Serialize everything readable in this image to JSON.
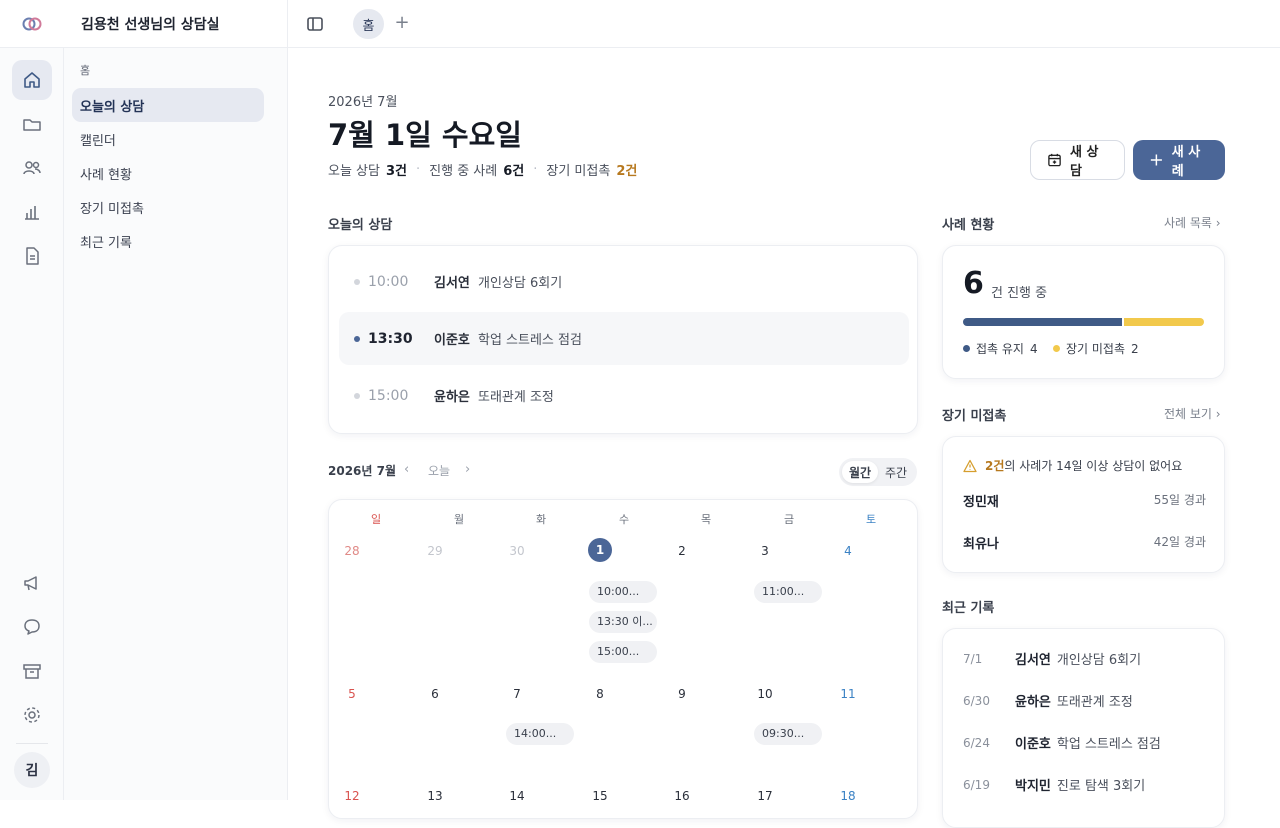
{
  "app": {
    "title": "김용천 선생님의 상담실"
  },
  "tabs": [
    {
      "label": "홈"
    }
  ],
  "user": {
    "avatar": "김"
  },
  "nav": {
    "section": "홈",
    "items": [
      {
        "label": "오늘의 상담",
        "active": true
      },
      {
        "label": "캘린더"
      },
      {
        "label": "사례 현황"
      },
      {
        "label": "장기 미접촉"
      },
      {
        "label": "최근 기록"
      }
    ]
  },
  "header": {
    "year_month": "2026년 7월",
    "date": "7월 1일 수요일",
    "summary": {
      "today_label": "오늘 상담",
      "today_value": "3건",
      "active_label": "진행 중 사례",
      "active_value": "6건",
      "long_label": "장기 미접촉",
      "long_value": "2건"
    },
    "new_session": "새 상담",
    "new_case": "새 사례"
  },
  "today": {
    "title": "오늘의 상담",
    "items": [
      {
        "time": "10:00",
        "name": "김서연",
        "desc": "개인상담 6회기"
      },
      {
        "time": "13:30",
        "name": "이준호",
        "desc": "학업 스트레스 점검"
      },
      {
        "time": "15:00",
        "name": "윤하은",
        "desc": "또래관계 조정"
      }
    ]
  },
  "calendar": {
    "title": "2026년 7월",
    "today_btn": "오늘",
    "view_month": "월간",
    "view_week": "주간",
    "weekdays": [
      "일",
      "월",
      "화",
      "수",
      "목",
      "금",
      "토"
    ],
    "weeks": [
      [
        "28",
        "29",
        "30",
        "1",
        "2",
        "3",
        "4"
      ],
      [
        "5",
        "6",
        "7",
        "8",
        "9",
        "10",
        "11"
      ],
      [
        "12",
        "13",
        "14",
        "15",
        "16",
        "17",
        "18"
      ]
    ],
    "events": {
      "wed1": [
        "10:00...",
        "13:30 이...",
        "15:00..."
      ],
      "fri3": "11:00...",
      "tue7": "14:00...",
      "fri10": "09:30..."
    }
  },
  "cases": {
    "title": "사례 현황",
    "link": "사례 목록",
    "count": "6",
    "count_label": "건 진행 중",
    "contact_label": "접촉 유지",
    "contact_value": "4",
    "long_label": "장기 미접촉",
    "long_value": "2",
    "colors": {
      "contact": "#3f5a86",
      "long": "#f2c94c"
    }
  },
  "longterm": {
    "title": "장기 미접촉",
    "link": "전체 보기",
    "warn_count": "2건",
    "warn_text": "의 사례가 14일 이상 상담이 없어요",
    "items": [
      {
        "name": "정민재",
        "days": "55일 경과"
      },
      {
        "name": "최유나",
        "days": "42일 경과"
      }
    ]
  },
  "recent": {
    "title": "최근 기록",
    "items": [
      {
        "date": "7/1",
        "name": "김서연",
        "desc": "개인상담 6회기"
      },
      {
        "date": "6/30",
        "name": "윤하은",
        "desc": "또래관계 조정"
      },
      {
        "date": "6/24",
        "name": "이준호",
        "desc": "학업 스트레스 점검"
      },
      {
        "date": "6/19",
        "name": "박지민",
        "desc": "진로 탐색 3회기"
      }
    ]
  }
}
